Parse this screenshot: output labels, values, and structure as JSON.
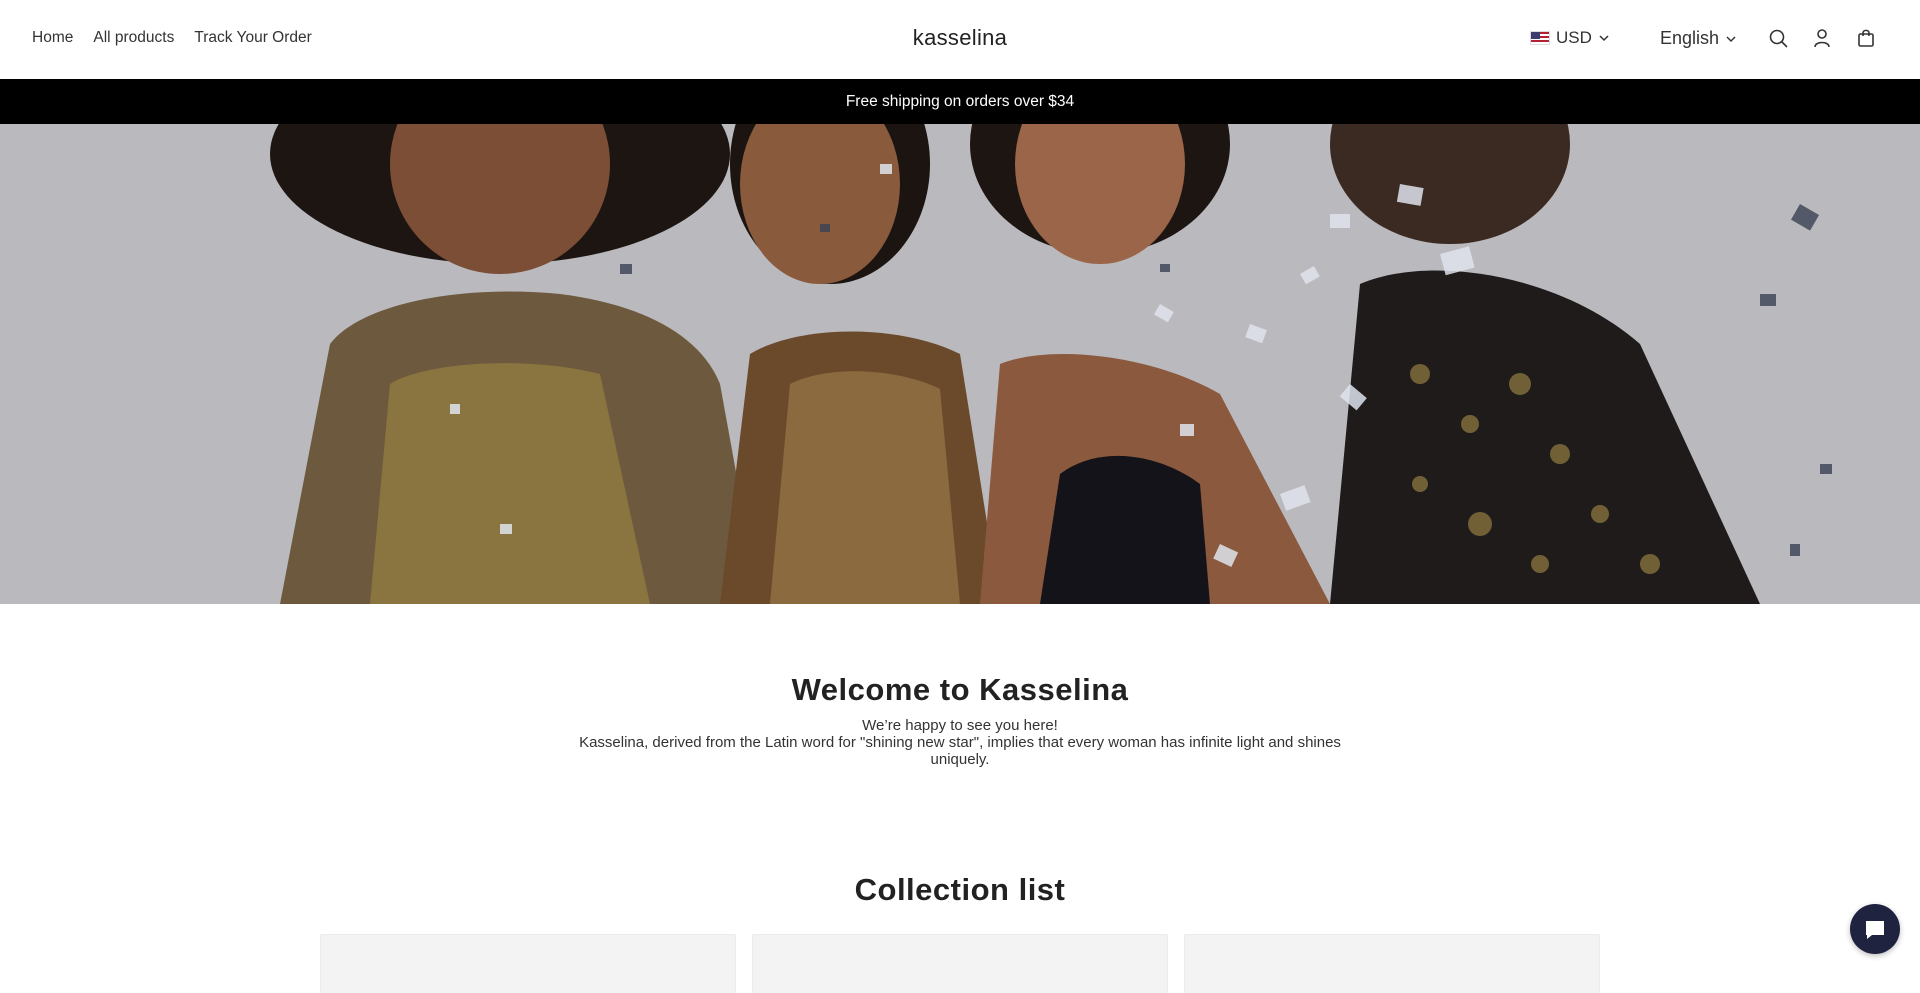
{
  "header": {
    "nav": [
      {
        "label": "Home"
      },
      {
        "label": "All products"
      },
      {
        "label": "Track Your Order"
      }
    ],
    "logo": "kasselina",
    "currency": "USD",
    "language": "English",
    "icons": [
      "search-icon",
      "account-icon",
      "cart-icon"
    ]
  },
  "announcement": "Free shipping on orders over $34",
  "intro": {
    "title": "Welcome to Kasselina",
    "line1": "We’re happy to see you here!",
    "line2": "Kasselina, derived from the Latin word for \"shining new star\", implies that every woman has infinite light and shines uniquely."
  },
  "collection": {
    "title": "Collection list"
  },
  "colors": {
    "announcement_bg": "#000000",
    "chat_button": "#1f2340"
  }
}
